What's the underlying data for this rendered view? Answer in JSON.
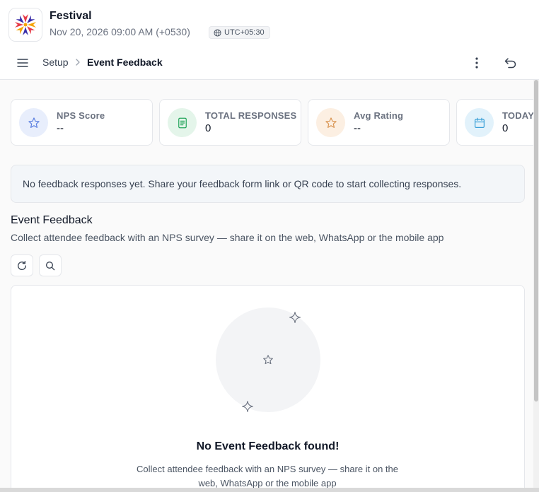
{
  "app": {
    "title": "Festival",
    "datetime": "Nov 20, 2026 09:00 AM (+0530)",
    "timezone_badge": "UTC+05:30",
    "logo_icon": "festival-flower-logo"
  },
  "toolbar": {
    "menu_icon": "hamburger-menu-icon",
    "breadcrumb": [
      "Setup",
      "Event Feedback"
    ],
    "kebab_icon": "more-vertical-icon",
    "undo_icon": "undo-icon"
  },
  "stats": [
    {
      "label": "NPS Score",
      "value": "--",
      "icon": "star-icon",
      "color": "#5b7fe0",
      "bg": "#e8eefc"
    },
    {
      "label": "TOTAL RESPONSES",
      "value": "0",
      "icon": "document-icon",
      "color": "#22a55a",
      "bg": "#e4f5ea"
    },
    {
      "label": "Avg Rating",
      "value": "--",
      "icon": "star-icon",
      "color": "#d99553",
      "bg": "#fcefe2"
    },
    {
      "label": "TODAY'S",
      "value": "0",
      "icon": "calendar-icon",
      "color": "#3aa0d8",
      "bg": "#e2f2fb"
    }
  ],
  "banner": {
    "text": "No feedback responses yet. Share your feedback form link or QR code to start collecting responses."
  },
  "section": {
    "title": "Event Feedback",
    "description": "Collect attendee feedback with an NPS survey — share it on the web, WhatsApp or the mobile app"
  },
  "actions": {
    "refresh_icon": "refresh-icon",
    "search_icon": "search-icon"
  },
  "empty_state": {
    "title": "No Event Feedback found!",
    "description": "Collect attendee feedback with an NPS survey — share it on the web, WhatsApp or the mobile app"
  }
}
